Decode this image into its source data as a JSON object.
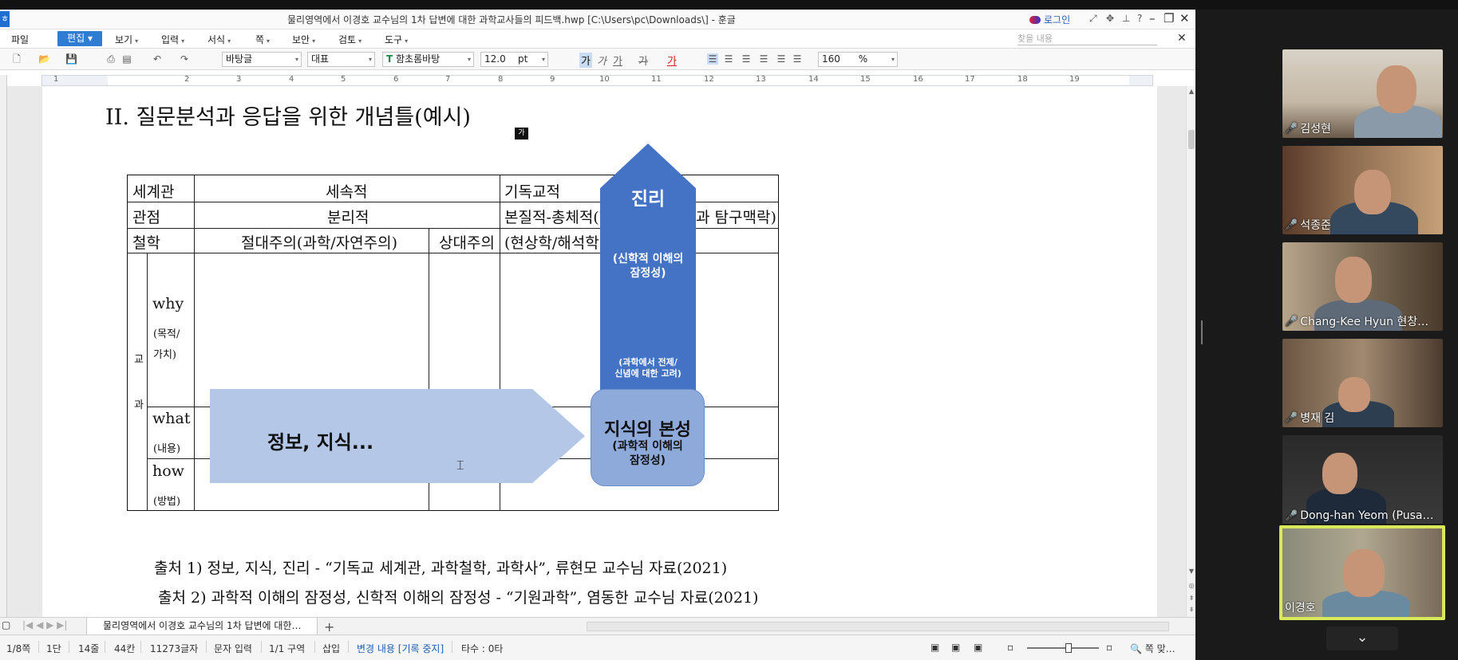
{
  "window": {
    "title": "물리영역에서 이경호 교수님의 1차 답변에 대한 과학교사들의 피드백.hwp [C:\\Users\\pc\\Downloads\\] - 훈글",
    "login_label": "로그인",
    "app_icon": "hancom-logo-icon"
  },
  "menu": {
    "items": [
      "파일",
      "편집",
      "보기",
      "입력",
      "서식",
      "쪽",
      "보안",
      "검토",
      "도구"
    ],
    "active": "편집",
    "search_placeholder": "찾을 내용"
  },
  "toolbar": {
    "style": "바탕글",
    "lang": "대표",
    "font": "함초롬바탕",
    "font_size": "12.0",
    "font_unit": "pt",
    "zoom": "160",
    "zoom_unit": "%",
    "format_buttons": [
      "가",
      "가",
      "가",
      "가",
      "가"
    ]
  },
  "ruler": {
    "numbers": [
      "1",
      "2",
      "3",
      "4",
      "5",
      "6",
      "7",
      "8",
      "9",
      "10",
      "11",
      "12",
      "13",
      "14",
      "15",
      "16",
      "17",
      "18",
      "19"
    ]
  },
  "document": {
    "heading": "II. 질문분석과 응답을 위한 개념틀(예시)",
    "caret_label": "가",
    "table": {
      "r1": [
        "세계관",
        "세속적",
        "기독교적"
      ],
      "r2": [
        "관점",
        "분리적",
        "본질적-총체적(학",
        "과 탐구맥락)"
      ],
      "r3": [
        "철학",
        "절대주의(과학/자연주의)",
        "상대주의",
        "(현상학/해석학)"
      ],
      "side": [
        "교",
        "과"
      ],
      "why": "why",
      "why_sub": [
        "(목적/",
        "가치)"
      ],
      "what": "what",
      "what_sub": "(내용)",
      "how": "how",
      "how_sub": "(방법)"
    },
    "shapes": {
      "info": "정보,   지식...",
      "truth": "진리",
      "truth_sub": [
        "(신학적 이해의",
        "잠정성)"
      ],
      "truth_note": [
        "(과학에서 전제/",
        "신념에 대한 고려)"
      ],
      "nature": "지식의 본성",
      "nature_sub": [
        "(과학적 이해의",
        "잠정성)"
      ]
    },
    "sources": [
      "출처 1) 정보, 지식, 진리 - “기독교 세계관, 과학철학, 과학사”, 류현모 교수님 자료(2021)",
      "출처 2) 과학적 이해의 잠정성, 신학적 이해의 잠정성 - “기원과학”, 염동한 교수님 자료(2021)"
    ]
  },
  "tabs": {
    "doc_tab": "물리영역에서 이경호 교수님의 1차 답변에 대한…"
  },
  "status": {
    "items": [
      "1/8쪽",
      "1단",
      "14줄",
      "44칸",
      "11273글자",
      "문자 입력",
      "1/1 구역",
      "삽입"
    ],
    "track": "변경 내용 [기록 중지]",
    "typing": "타수 : 0타",
    "fit": "쪽 맞…"
  },
  "participants": [
    {
      "name": "김성현",
      "muted": true
    },
    {
      "name": "석종준",
      "muted": true
    },
    {
      "name": "Chang-Kee Hyun 현창…",
      "muted": true
    },
    {
      "name": "병재 김",
      "muted": true
    },
    {
      "name": "Dong-han Yeom (Pusa…",
      "muted": true
    },
    {
      "name": "이경호",
      "muted": false,
      "active": true
    }
  ],
  "colors": {
    "accent": "#2f7cd3",
    "arrow_light": "#b4c7e7",
    "arrow_dark": "#4472c4",
    "box": "#8eaadb",
    "active_speaker": "#d7e85a",
    "muted": "#e23333"
  }
}
